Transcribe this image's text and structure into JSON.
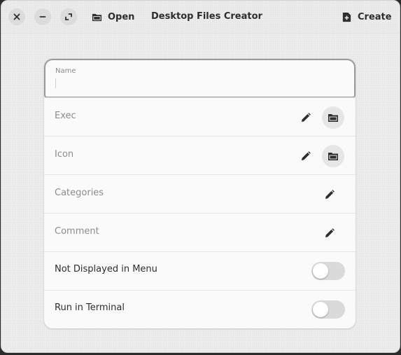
{
  "window": {
    "title": "Desktop Files Creator",
    "open_label": "Open",
    "create_label": "Create"
  },
  "form": {
    "name": {
      "label": "Name",
      "value": ""
    },
    "rows": [
      {
        "label": "Exec",
        "has_browse": true
      },
      {
        "label": "Icon",
        "has_browse": true
      },
      {
        "label": "Categories",
        "has_browse": false
      },
      {
        "label": "Comment",
        "has_browse": false
      }
    ],
    "switches": [
      {
        "label": "Not Displayed in Menu",
        "on": false
      },
      {
        "label": "Run in Terminal",
        "on": false
      }
    ]
  }
}
